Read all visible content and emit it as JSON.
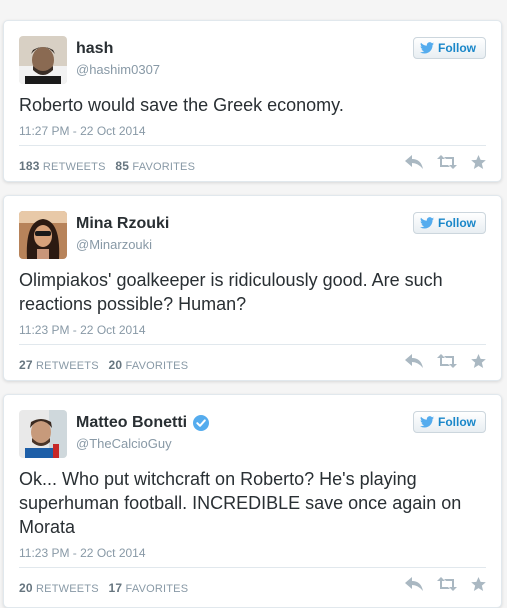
{
  "colors": {
    "accent": "#1a87c9",
    "verified": "#55acee",
    "muted": "#8899a6",
    "action_icon": "#aab8c2"
  },
  "tweets": [
    {
      "name": "hash",
      "handle": "@hashim0307",
      "verified": false,
      "follow_label": "Follow",
      "text": "Roberto would save the Greek economy.",
      "time": "11:27 PM - 22 Oct 2014",
      "retweets": "183",
      "retweets_label": "RETWEETS",
      "favorites": "85",
      "favorites_label": "FAVORITES",
      "icons": [
        "reply-icon",
        "retweet-icon",
        "favorite-icon"
      ]
    },
    {
      "name": "Mina Rzouki",
      "handle": "@Minarzouki",
      "verified": false,
      "follow_label": "Follow",
      "text": "Olimpiakos' goalkeeper is ridiculously good. Are such reactions possible? Human?",
      "time": "11:23 PM - 22 Oct 2014",
      "retweets": "27",
      "retweets_label": "RETWEETS",
      "favorites": "20",
      "favorites_label": "FAVORITES",
      "icons": [
        "reply-icon",
        "retweet-icon",
        "favorite-icon"
      ]
    },
    {
      "name": "Matteo Bonetti",
      "handle": "@TheCalcioGuy",
      "verified": true,
      "follow_label": "Follow",
      "text": "Ok... Who put witchcraft on Roberto? He's playing superhuman football. INCREDIBLE save once again on Morata",
      "time": "11:23 PM - 22 Oct 2014",
      "retweets": "20",
      "retweets_label": "RETWEETS",
      "favorites": "17",
      "favorites_label": "FAVORITES",
      "icons": [
        "reply-icon",
        "retweet-icon",
        "favorite-icon"
      ]
    }
  ]
}
